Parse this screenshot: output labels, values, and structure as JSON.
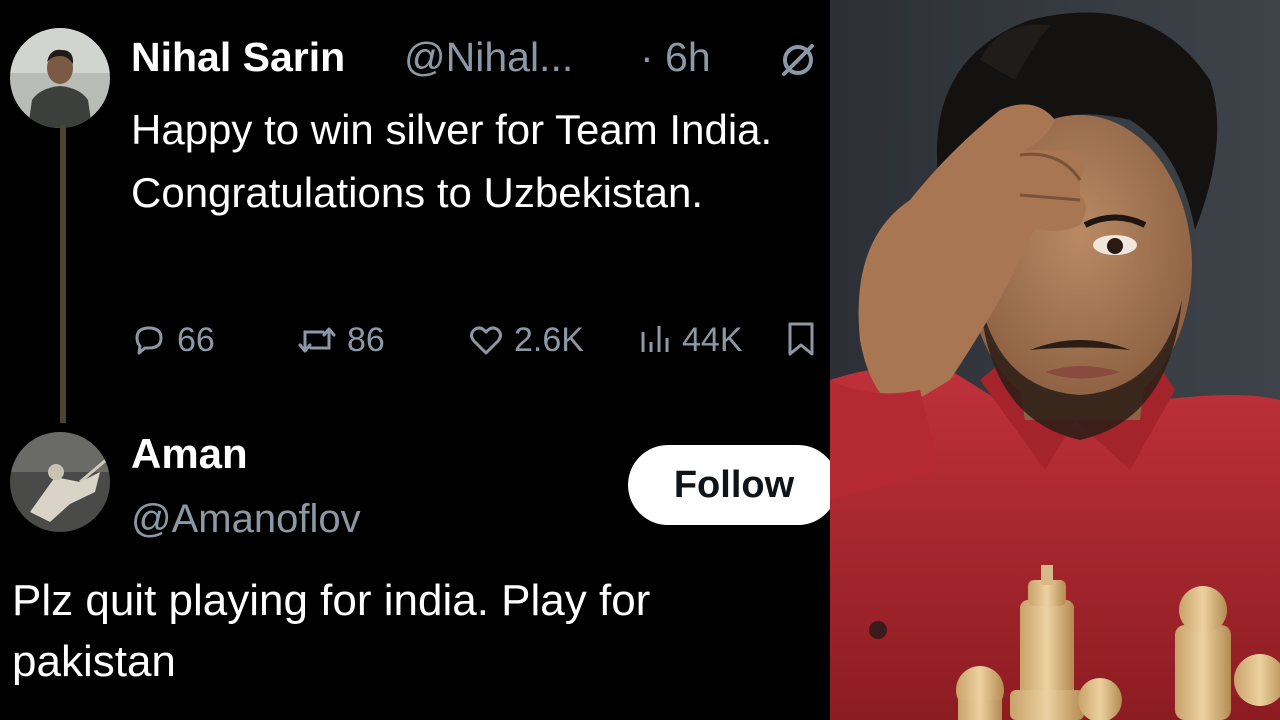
{
  "tweet": {
    "author_name": "Nihal Sarin",
    "handle": "@Nihal...",
    "time": "· 6h",
    "text": "Happy to win silver for Team India. Congratulations to Uzbekistan.",
    "icons": {
      "grok": "slashed-circle-icon"
    },
    "stats": {
      "replies": "66",
      "reposts": "86",
      "likes": "2.6K",
      "views": "44K"
    }
  },
  "reply": {
    "author_name": "Aman",
    "handle": "@Amanoflov",
    "follow_label": "Follow",
    "text": "Plz quit playing for india. Play for pakistan"
  },
  "colors": {
    "background": "#000000",
    "text": "#ffffff",
    "muted": "#8b98a5",
    "shirt": "#b3262d"
  }
}
